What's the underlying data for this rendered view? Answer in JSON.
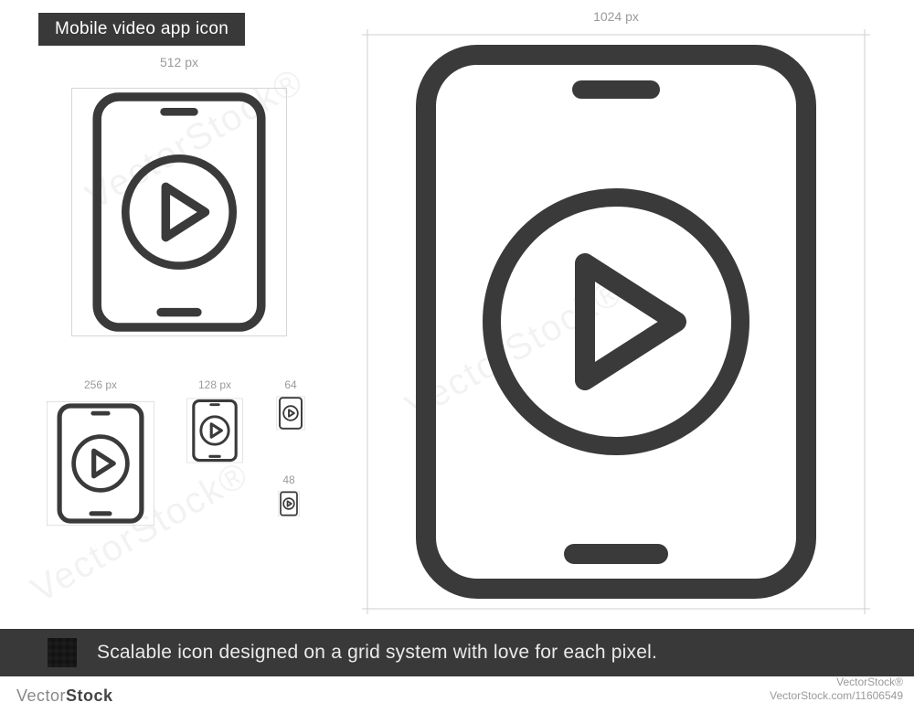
{
  "title": "Mobile video app icon",
  "footer": "Scalable icon designed on a grid system with love for each pixel.",
  "brand_light": "Vector",
  "brand_bold": "Stock",
  "attribution_site": "VectorStock®",
  "attribution_id": "VectorStock.com/11606549",
  "watermark": "VectorStock®",
  "sizes": {
    "s1024": "1024 px",
    "s512": "512 px",
    "s256": "256 px",
    "s128": "128 px",
    "s64": "64",
    "s48": "48"
  },
  "colors": {
    "stroke": "#3a3a3a",
    "guide": "#cfcfcf",
    "label": "#9a9a9a"
  }
}
